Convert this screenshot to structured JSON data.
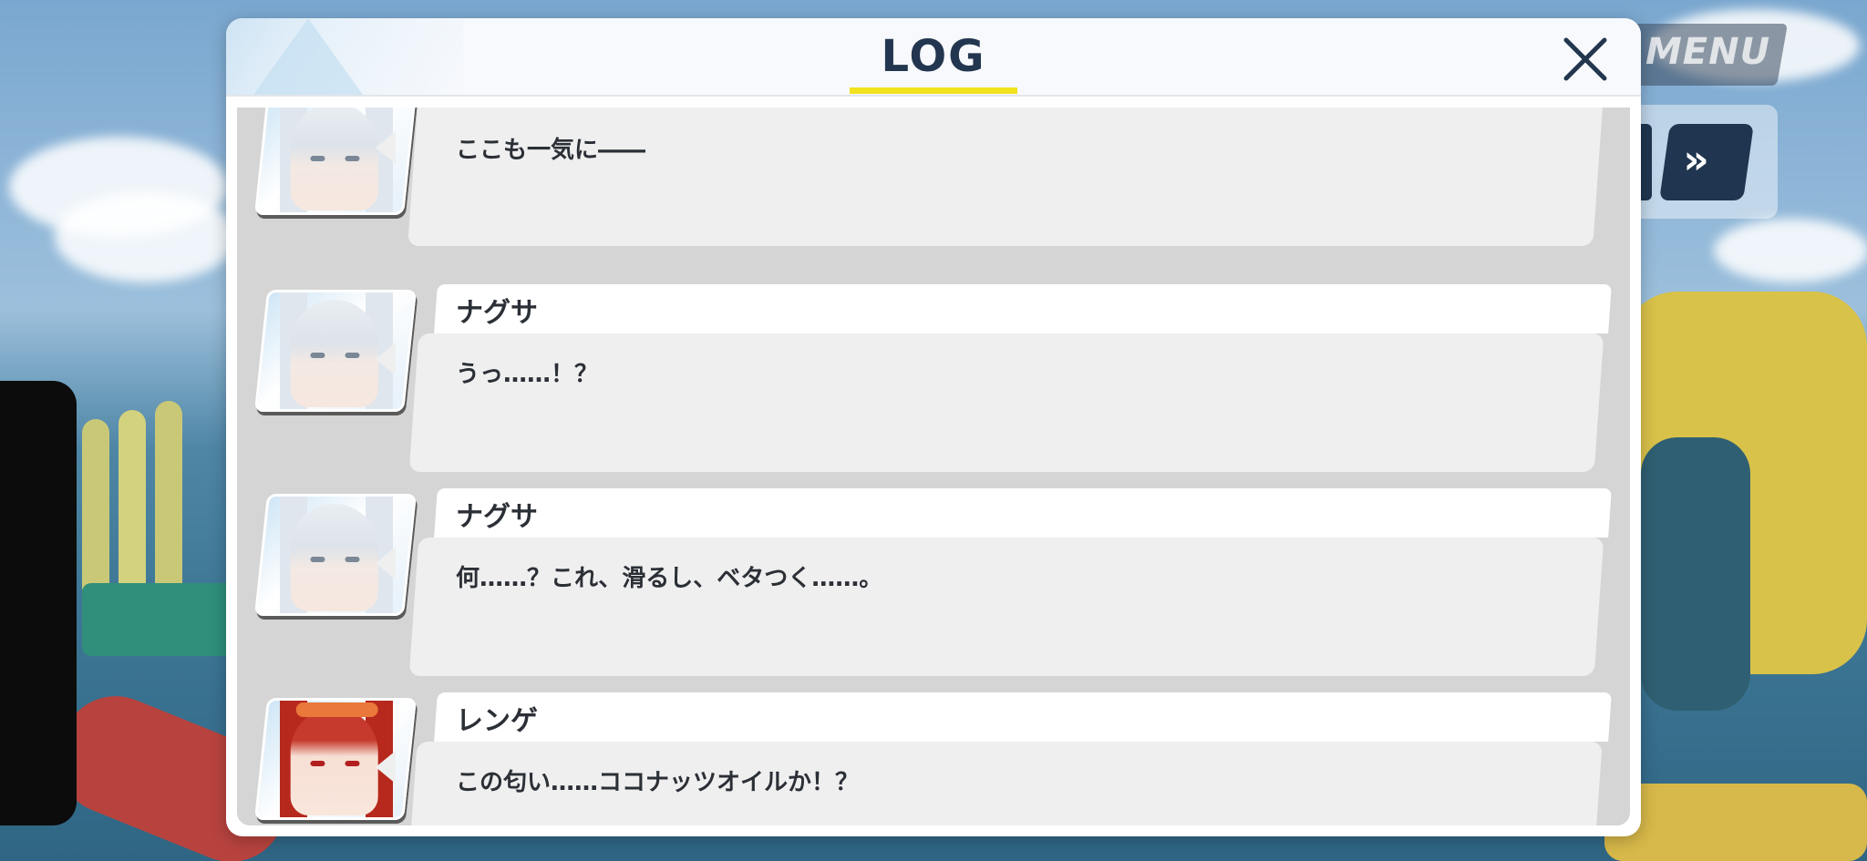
{
  "overlay": {
    "menu_label": "MENU",
    "fast_forward_label": "»"
  },
  "log": {
    "title": "LOG",
    "close_label": "×",
    "accent_color": "#f2e21d",
    "entries": [
      {
        "speaker": "",
        "message": "ここも一気に――",
        "portrait": "white-haired-girl-portrait"
      },
      {
        "speaker": "ナグサ",
        "message": "うっ……！？",
        "portrait": "white-haired-girl-portrait"
      },
      {
        "speaker": "ナグサ",
        "message": "何……？これ、滑るし、ベタつく……。",
        "portrait": "white-haired-girl-portrait"
      },
      {
        "speaker": "レンゲ",
        "message": "この匂い……ココナッツオイルか！？",
        "portrait": "red-haired-girl-portrait"
      }
    ]
  }
}
